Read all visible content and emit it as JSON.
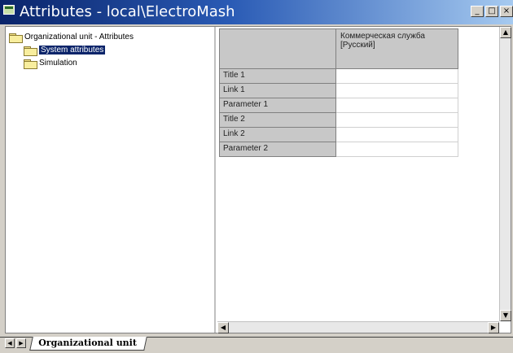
{
  "window": {
    "title": "Attributes - local\\ElectroMash",
    "controls": {
      "minimize": "_",
      "maximize": "□",
      "close": "×"
    }
  },
  "tree": {
    "items": [
      {
        "label": "Organizational unit - Attributes",
        "level": 0,
        "selected": false
      },
      {
        "label": "System attributes",
        "level": 1,
        "selected": true
      },
      {
        "label": "Simulation",
        "level": 1,
        "selected": false
      }
    ]
  },
  "grid": {
    "column_header": "Коммерческая служба [Русский]",
    "rows": [
      {
        "label": "Title 1",
        "value": ""
      },
      {
        "label": "Link 1",
        "value": ""
      },
      {
        "label": "Parameter 1",
        "value": ""
      },
      {
        "label": "Title 2",
        "value": ""
      },
      {
        "label": "Link 2",
        "value": ""
      },
      {
        "label": "Parameter 2",
        "value": ""
      }
    ]
  },
  "tabs": {
    "active": "Organizational unit"
  },
  "icons": {
    "app": "app-icon",
    "folder": "folder-icon",
    "scroll_up": "arrow-up-icon",
    "scroll_down": "arrow-down-icon",
    "scroll_left": "arrow-left-icon",
    "scroll_right": "arrow-right-icon"
  }
}
